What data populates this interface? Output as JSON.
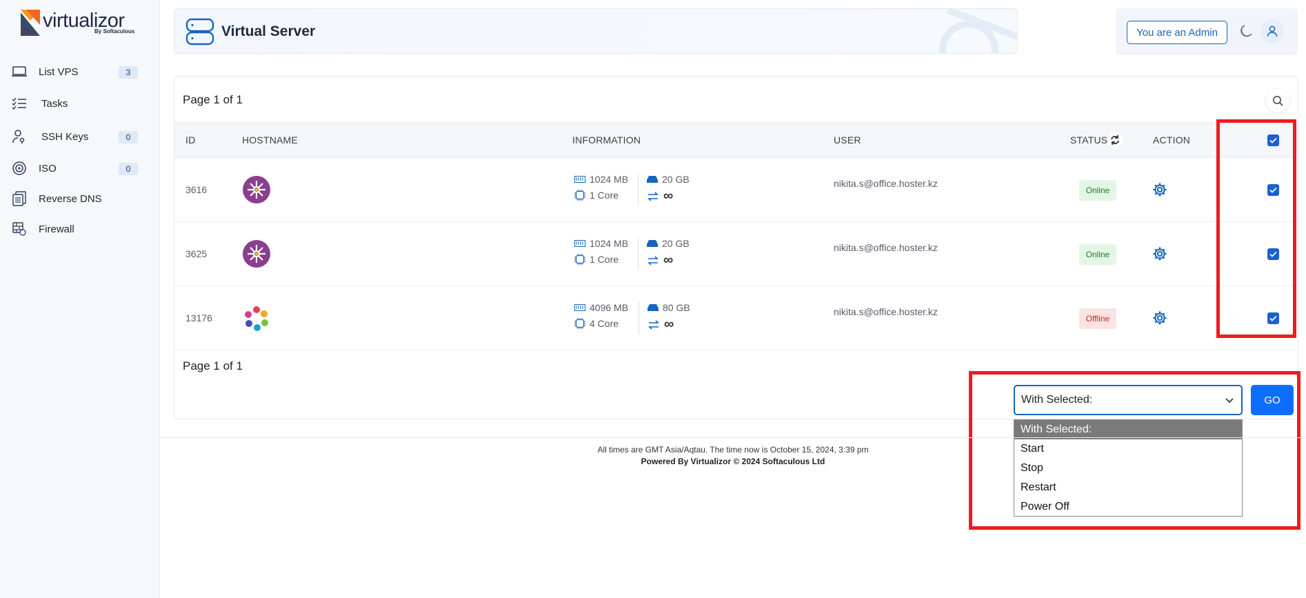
{
  "brand": {
    "name": "virtualizor",
    "by": "By Softaculous"
  },
  "sidebar": {
    "items": [
      {
        "label": "List VPS",
        "badge": "3",
        "icon": "laptop-icon"
      },
      {
        "label": "Tasks",
        "badge": null,
        "icon": "tasks-icon"
      },
      {
        "label": "SSH Keys",
        "badge": "0",
        "icon": "key-user-icon"
      },
      {
        "label": "ISO",
        "badge": "0",
        "icon": "disc-icon"
      },
      {
        "label": "Reverse DNS",
        "badge": null,
        "icon": "dns-icon"
      },
      {
        "label": "Firewall",
        "badge": null,
        "icon": "firewall-icon"
      }
    ]
  },
  "header": {
    "title": "Virtual Server",
    "admin_label": "You are an Admin"
  },
  "table": {
    "page_info_top": "Page 1 of 1",
    "page_info_bottom": "Page 1 of 1",
    "columns": {
      "id": "ID",
      "hostname": "HOSTNAME",
      "information": "INFORMATION",
      "user": "USER",
      "status": "STATUS",
      "action": "ACTION"
    },
    "rows": [
      {
        "id": "3616",
        "os": "almalinux",
        "ram": "1024 MB",
        "disk": "20 GB",
        "cpu": "1 Core",
        "bandwidth": "∞",
        "user": "nikita.s@office.hoster.kz",
        "status": "Online",
        "checked": true
      },
      {
        "id": "3625",
        "os": "almalinux",
        "ram": "1024 MB",
        "disk": "20 GB",
        "cpu": "1 Core",
        "bandwidth": "∞",
        "user": "nikita.s@office.hoster.kz",
        "status": "Online",
        "checked": true
      },
      {
        "id": "13176",
        "os": "rocky",
        "ram": "4096 MB",
        "disk": "80 GB",
        "cpu": "4 Core",
        "bandwidth": "∞",
        "user": "nikita.s@office.hoster.kz",
        "status": "Offline",
        "checked": true
      }
    ]
  },
  "bulk": {
    "selected_value": "With Selected:",
    "go_label": "GO",
    "options": [
      "With Selected:",
      "Start",
      "Stop",
      "Restart",
      "Power Off"
    ]
  },
  "footer": {
    "line1": "All times are GMT Asia/Aqtau. The time now is October 15, 2024, 3:39 pm",
    "line2": "Powered By Virtualizor © 2024 Softaculous Ltd"
  },
  "colors": {
    "accent": "#0d6efd",
    "highlight": "#ee1c1c",
    "online_bg": "#e3f6e6",
    "offline_bg": "#fbe3e3"
  }
}
